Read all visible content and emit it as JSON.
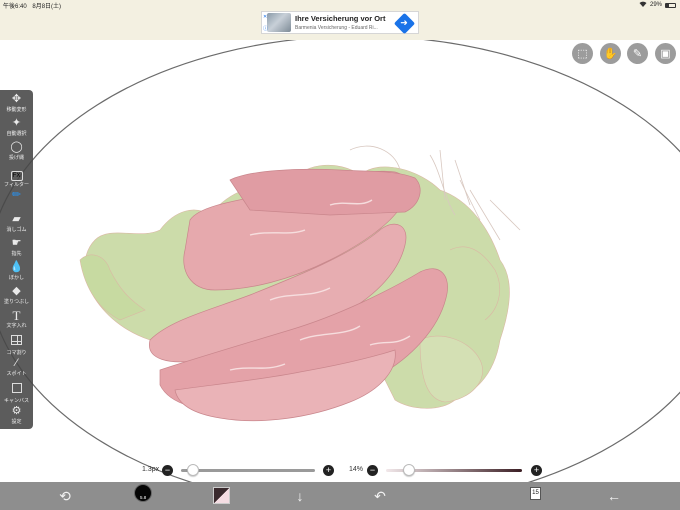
{
  "status_bar": {
    "time": "午後6:40",
    "date": "8月8日(土)",
    "battery": "29%"
  },
  "ad": {
    "info_glyph": "ⓘ",
    "close_glyph": "✕",
    "title": "Ihre Versicherung vor Ort",
    "subtitle": "Barmenia Versicherung - Eduard Ri..."
  },
  "top_right_buttons": [
    {
      "name": "selection-icon"
    },
    {
      "name": "hand-icon"
    },
    {
      "name": "pen-icon"
    },
    {
      "name": "gallery-icon"
    }
  ],
  "toolbar": {
    "tools": [
      {
        "name": "move-transform",
        "label": "移動変形",
        "icon": "move-icon"
      },
      {
        "name": "auto-select",
        "label": "自動選択",
        "icon": "magic-wand-icon"
      },
      {
        "name": "lasso",
        "label": "投げ縄",
        "icon": "lasso-icon"
      },
      {
        "name": "filter",
        "label": "フィルター",
        "icon": "fx-icon"
      },
      {
        "name": "brush",
        "label": "",
        "icon": "brush-icon",
        "active": true
      },
      {
        "name": "eraser",
        "label": "消しゴム",
        "icon": "eraser-icon"
      },
      {
        "name": "finger",
        "label": "指先",
        "icon": "smudge-icon"
      },
      {
        "name": "blur",
        "label": "ぼかし",
        "icon": "blur-drop-icon"
      },
      {
        "name": "fill",
        "label": "塗りつぶし",
        "icon": "fill-icon"
      },
      {
        "name": "text",
        "label": "文字入れ",
        "icon": "text-icon"
      },
      {
        "name": "frame-divider",
        "label": "コマ割り",
        "icon": "frame-icon"
      },
      {
        "name": "eyedropper",
        "label": "スポイト",
        "icon": "eyedropper-icon"
      },
      {
        "name": "canvas",
        "label": "キャンバス",
        "icon": "canvas-icon"
      },
      {
        "name": "settings",
        "label": "設定",
        "icon": "gear-icon"
      }
    ]
  },
  "brush_size": {
    "value_label": "1.3px",
    "level": 0.05
  },
  "opacity": {
    "value_label": "14%",
    "level": 0.14
  },
  "bottom_bar": {
    "brush_size_label": "5.8",
    "layer_count": "15"
  },
  "colors": {
    "accent": "#2a8fe8",
    "current_color": "#050505",
    "toolbar_bg": "#464646",
    "bottom_bar_bg": "#8e8e8e",
    "meat": "#e3a4a8",
    "lettuce": "#c9dca6"
  }
}
